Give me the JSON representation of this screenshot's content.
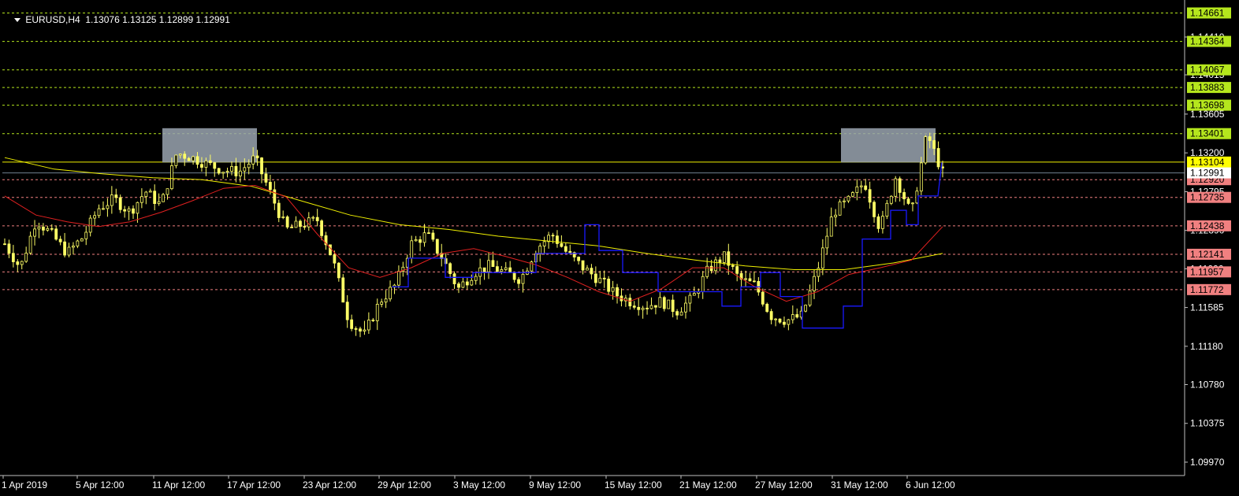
{
  "window": {
    "symbol": "EURUSD,H4",
    "ohlc": "1.13076 1.13125 1.12899 1.12991"
  },
  "colors": {
    "background": "#000000",
    "candle": "#ffff66",
    "ma_red": "#e02020",
    "ma_yellow": "#f0f000",
    "stop_line": "#1a1aff",
    "resistance_level": "#b5e61d",
    "support_level": "#f08080",
    "current_price_label": "#ffff00",
    "zone_fill": "#9aa4b0"
  },
  "chart_data": {
    "type": "candlestick",
    "symbol": "EURUSD",
    "timeframe": "H4",
    "price_axis_ticks": [
      "1.14410",
      "1.14015",
      "1.13605",
      "1.13200",
      "1.12795",
      "1.12390",
      "1.11990",
      "1.11585",
      "1.11180",
      "1.10780",
      "1.10375",
      "1.09970"
    ],
    "time_axis_ticks": [
      "1 Apr 2019",
      "5 Apr 12:00",
      "11 Apr 12:00",
      "17 Apr 12:00",
      "23 Apr 12:00",
      "29 Apr 12:00",
      "3 May 12:00",
      "9 May 12:00",
      "15 May 12:00",
      "21 May 12:00",
      "27 May 12:00",
      "31 May 12:00",
      "6 Jun 12:00"
    ],
    "resistance_levels": [
      "1.14661",
      "1.14364",
      "1.14067",
      "1.13883",
      "1.13698",
      "1.13401"
    ],
    "current_price_tag": "1.13104",
    "bid_tag": "1.12991",
    "support_levels": [
      "1.12920",
      "1.12735",
      "1.12438",
      "1.12141",
      "1.11957",
      "1.11772"
    ],
    "horizontal_line": 1.13104,
    "bid_line": 1.12991,
    "zones": [
      {
        "from": "11 Apr 12:00",
        "to": "17 Apr 12:00",
        "low": 1.131,
        "high": 1.134
      },
      {
        "from": "31 May 12:00",
        "to": "6 Jun 12:00",
        "low": 1.131,
        "high": 1.134
      }
    ],
    "close_path": [
      1.1225,
      1.12,
      1.125,
      1.1235,
      1.1215,
      1.1232,
      1.1262,
      1.1272,
      1.1258,
      1.128,
      1.1265,
      1.132,
      1.1315,
      1.1308,
      1.1302,
      1.13,
      1.1315,
      1.1278,
      1.124,
      1.1245,
      1.125,
      1.1208,
      1.1145,
      1.113,
      1.1165,
      1.1182,
      1.1225,
      1.1235,
      1.121,
      1.1178,
      1.1195,
      1.1202,
      1.1195,
      1.1188,
      1.122,
      1.1235,
      1.1215,
      1.12,
      1.1188,
      1.1173,
      1.1165,
      1.116,
      1.1165,
      1.1155,
      1.1168,
      1.1198,
      1.1212,
      1.1188,
      1.1182,
      1.115,
      1.1145,
      1.115,
      1.1198,
      1.1258,
      1.127,
      1.129,
      1.124,
      1.1295,
      1.1255,
      1.134,
      1.1299
    ],
    "ma_red": [
      1.1275,
      1.1255,
      1.1248,
      1.1243,
      1.1248,
      1.1258,
      1.127,
      1.1283,
      1.1286,
      1.1274,
      1.1235,
      1.12,
      1.119,
      1.12,
      1.1215,
      1.122,
      1.1212,
      1.1203,
      1.119,
      1.1175,
      1.1165,
      1.1178,
      1.12,
      1.12,
      1.118,
      1.1165,
      1.1175,
      1.1193,
      1.12,
      1.1208,
      1.1243
    ],
    "ma_yellow": [
      1.1315,
      1.1303,
      1.1298,
      1.1294,
      1.1292,
      1.1285,
      1.127,
      1.1255,
      1.1245,
      1.124,
      1.1233,
      1.1228,
      1.1223,
      1.1215,
      1.1208,
      1.1202,
      1.1198,
      1.1198,
      1.1205,
      1.1215
    ]
  }
}
